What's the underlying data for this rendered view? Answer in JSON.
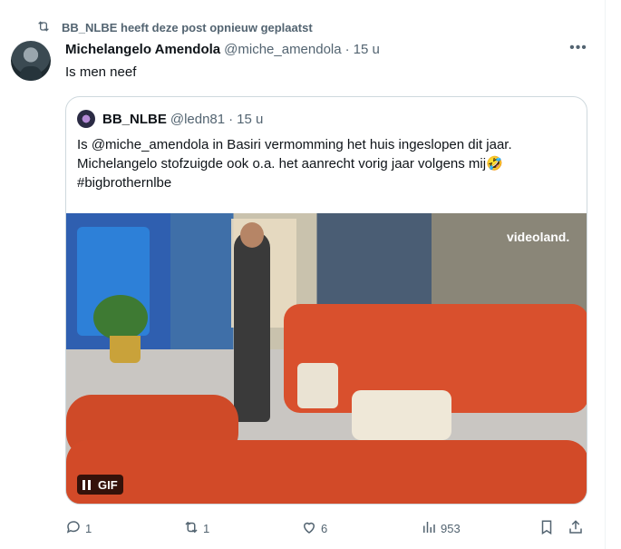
{
  "repost": {
    "label": "BB_NLBE heeft deze post opnieuw geplaatst",
    "icon": "repost-icon"
  },
  "post": {
    "author_name": "Michelangelo Amendola",
    "author_handle": "@miche_amendola",
    "separator": "·",
    "time": "15 u",
    "text": "Is men neef",
    "avatar_icon": "avatar"
  },
  "quote": {
    "author_name": "BB_NLBE",
    "author_handle": "@ledn81",
    "separator": "·",
    "time": "15 u",
    "text_line1": "Is @miche_amendola in Basiri vermomming het huis ingeslopen dit jaar.",
    "text_line2": "Michelangelo stofzuigde ook o.a. het aanrecht vorig jaar volgens mij🤣",
    "text_line3": "#bigbrothernlbe",
    "media": {
      "watermark": "videoland.",
      "badge_label": "GIF",
      "badge_icon": "pause-icon"
    }
  },
  "actions": {
    "reply_count": "1",
    "repost_count": "1",
    "like_count": "6",
    "views_count": "953",
    "icons": [
      "reply-icon",
      "repost-icon",
      "like-icon",
      "views-icon",
      "bookmark-icon",
      "share-icon"
    ]
  },
  "colors": {
    "text": "#0f1419",
    "muted": "#536471",
    "border": "#cfd9de"
  }
}
